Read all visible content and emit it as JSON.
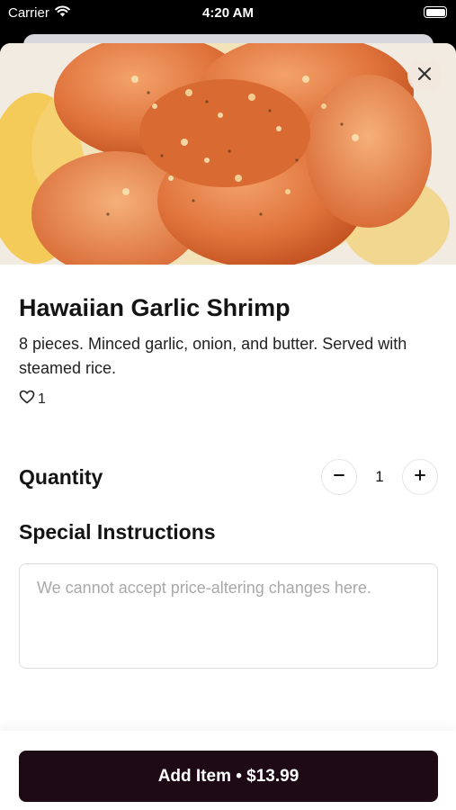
{
  "status_bar": {
    "carrier": "Carrier",
    "time": "4:20 AM"
  },
  "item": {
    "name": "Hawaiian Garlic Shrimp",
    "description": "8 pieces. Minced garlic, onion, and butter. Served with steamed rice.",
    "likes": "1"
  },
  "quantity": {
    "label": "Quantity",
    "value": "1"
  },
  "special_instructions": {
    "label": "Special Instructions",
    "placeholder": "We cannot accept price-altering changes here."
  },
  "footer": {
    "add_button_label": "Add Item • $13.99"
  },
  "colors": {
    "button_bg": "#1e0a14",
    "background": "#ffffff"
  }
}
